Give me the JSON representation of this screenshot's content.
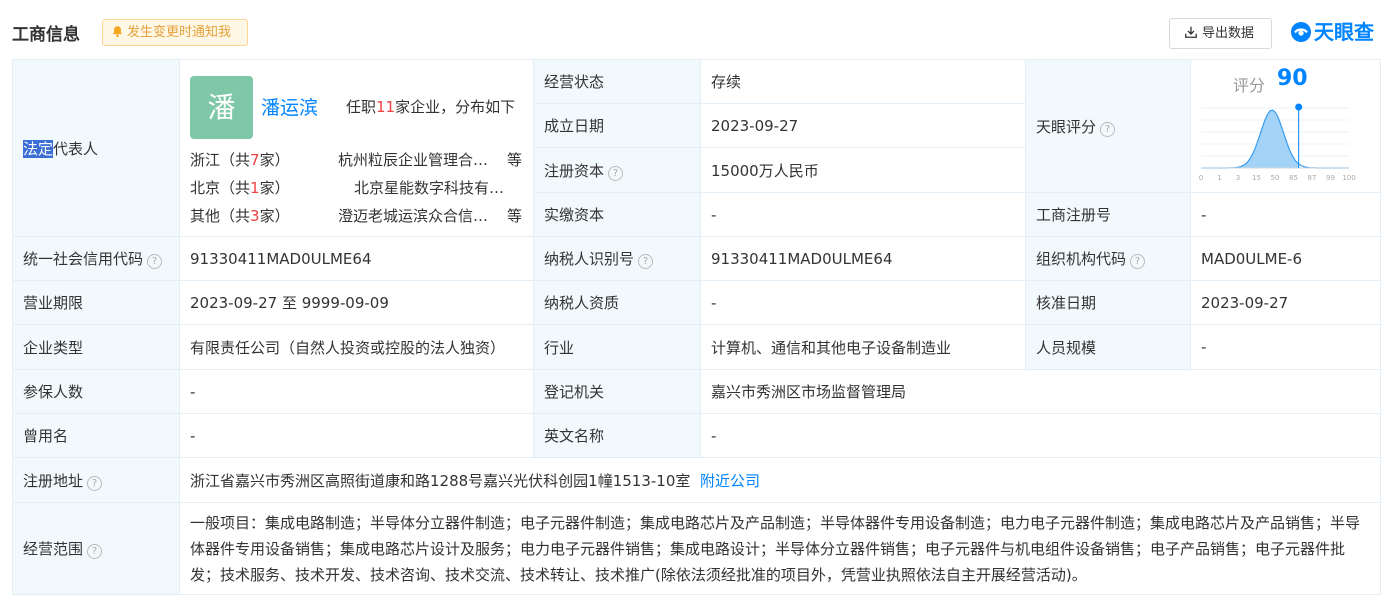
{
  "header": {
    "title": "工商信息",
    "notify_label": "发生变更时通知我",
    "export_label": "导出数据",
    "logo_text": "天眼查",
    "brand_color": "#0084ff"
  },
  "rep": {
    "label_hl": "法定",
    "label_rest": "代表人",
    "avatar_char": "潘",
    "name": "潘运滨",
    "job_pre": "任职",
    "job_count": "11",
    "job_post": "家企业，分布如下",
    "distribution": [
      {
        "prov_pre": "浙江（共",
        "count": "7",
        "prov_post": "家）",
        "company": "杭州粒辰企业管理合伙企业（有限合伙）",
        "more": "等"
      },
      {
        "prov_pre": "北京（共",
        "count": "1",
        "prov_post": "家）",
        "company": "北京星能数字科技有限公司",
        "more": ""
      },
      {
        "prov_pre": "其他（共",
        "count": "3",
        "prov_post": "家）",
        "company": "澄迈老城运滨众合信息咨询中心",
        "more": "等"
      }
    ]
  },
  "rows": {
    "status_label": "经营状态",
    "status_value": "存续",
    "founded_label": "成立日期",
    "founded_value": "2023-09-27",
    "capital_label": "注册资本",
    "capital_value": "15000万人民币",
    "paid_label": "实缴资本",
    "paid_value": "-",
    "tianyan_label": "天眼评分",
    "reg_no_label": "工商注册号",
    "reg_no_value": "-",
    "credit_label": "统一社会信用代码",
    "credit_value": "91330411MAD0ULME64",
    "taxid_label": "纳税人识别号",
    "taxid_value": "91330411MAD0ULME64",
    "org_label": "组织机构代码",
    "org_value": "MAD0ULME-6",
    "term_label": "营业期限",
    "term_value": "2023-09-27 至 9999-09-09",
    "taxq_label": "纳税人资质",
    "taxq_value": "-",
    "approve_label": "核准日期",
    "approve_value": "2023-09-27",
    "type_label": "企业类型",
    "type_value": "有限责任公司（自然人投资或控股的法人独资）",
    "industry_label": "行业",
    "industry_value": "计算机、通信和其他电子设备制造业",
    "staff_label": "人员规模",
    "staff_value": "-",
    "insured_label": "参保人数",
    "insured_value": "-",
    "authority_label": "登记机关",
    "authority_value": "嘉兴市秀洲区市场监督管理局",
    "former_label": "曾用名",
    "former_value": "-",
    "english_label": "英文名称",
    "english_value": "-",
    "address_label": "注册地址",
    "address_value": "浙江省嘉兴市秀洲区高照街道康和路1288号嘉兴光伏科创园1幢1513-10室",
    "nearby_label": "附近公司",
    "scope_label": "经营范围",
    "scope_value": "一般项目：集成电路制造；半导体分立器件制造；电子元器件制造；集成电路芯片及产品制造；半导体器件专用设备制造；电力电子元器件制造；集成电路芯片及产品销售；半导体器件专用设备销售；集成电路芯片设计及服务；电力电子元器件销售；集成电路设计；半导体分立器件销售；电子元器件与机电组件设备销售；电子产品销售；电子元器件批发；技术服务、技术开发、技术咨询、技术交流、技术转让、技术推广(除依法须经批准的项目外，凭营业执照依法自主开展经营活动)。"
  },
  "score": {
    "label": "评分",
    "value": 90,
    "ticks": [
      "0",
      "1",
      "3",
      "15",
      "50",
      "85",
      "87",
      "99",
      "100"
    ]
  }
}
